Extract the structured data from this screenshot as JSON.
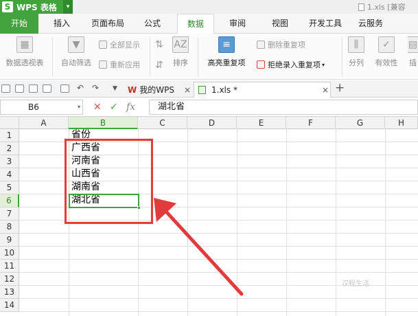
{
  "titlebar": {
    "app_name": "WPS 表格",
    "logo_letter": "S",
    "dropdown": "▾",
    "doc_title": "1.xls [兼容"
  },
  "menu": {
    "tabs": [
      "开始",
      "插入",
      "页面布局",
      "公式",
      "数据",
      "审阅",
      "视图",
      "开发工具",
      "云服务"
    ],
    "active_tab": "数据"
  },
  "ribbon": {
    "pivot": "数据透视表",
    "autofilter": "自动筛选",
    "show_all": "全部显示",
    "reapply": "重新应用",
    "sort": "排序",
    "highlight_dup": "高亮重复项",
    "remove_dup": "删除重复项",
    "reject_dup": "拒绝录入重复项",
    "split": "分列",
    "validity": "有效性",
    "more": "插"
  },
  "quickbar": {
    "tab_mywps": "我的WPS",
    "tab_file": "1.xls *",
    "close": "×",
    "new_tab": "+"
  },
  "formula_bar": {
    "cell_ref": "B6",
    "dropdown": "▾",
    "cancel": "✕",
    "confirm": "✓",
    "fx": "fx",
    "content": "湖北省"
  },
  "sheet": {
    "columns": [
      "A",
      "B",
      "C",
      "D",
      "E",
      "F",
      "G",
      "H"
    ],
    "rows": [
      "1",
      "2",
      "3",
      "4",
      "5",
      "6",
      "7",
      "8",
      "9",
      "10",
      "11",
      "12",
      "13",
      "14"
    ],
    "selected_column": "B",
    "selected_row": "6",
    "column_b_values": [
      "省份",
      "广西省",
      "河南省",
      "山西省",
      "湖南省",
      "湖北省"
    ]
  },
  "annotation": {
    "highlight_color": "#e13b3b"
  },
  "watermark": {
    "text": "汉程生活"
  },
  "colors": {
    "accent": "#40a33b",
    "selection": "#e2efd9"
  }
}
